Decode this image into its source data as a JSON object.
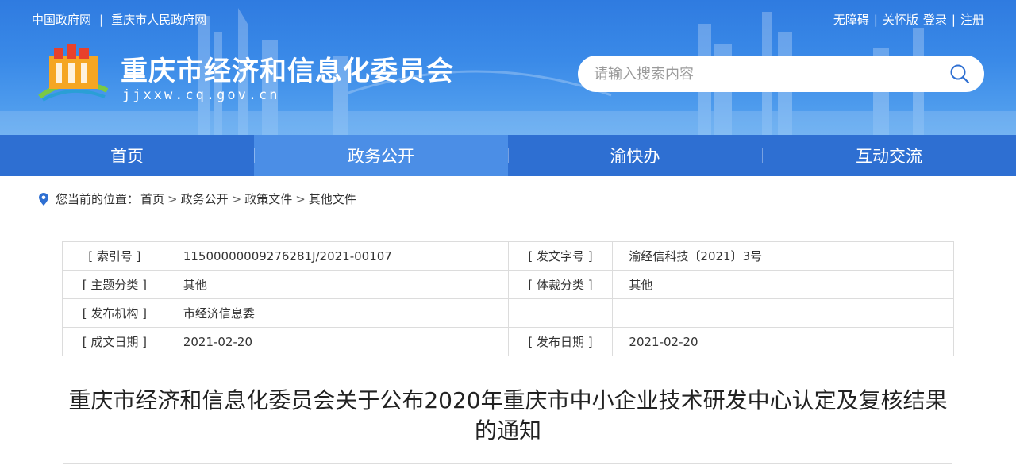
{
  "header": {
    "top_links_left": [
      "中国政府网",
      "重庆市人民政府网"
    ],
    "top_links_right": [
      "无障碍",
      "关怀版",
      "登录",
      "注册"
    ],
    "separator": "|",
    "site_title": "重庆市经济和信息化委员会",
    "site_domain": "jjxxw.cq.gov.cn",
    "search_placeholder": "请输入搜索内容"
  },
  "nav": {
    "items": [
      "首页",
      "政务公开",
      "渝快办",
      "互动交流"
    ],
    "active_index": 1
  },
  "breadcrumb": {
    "prefix": "您当前的位置：",
    "items": [
      "首页",
      "政务公开",
      "政策文件",
      "其他文件"
    ],
    "separator": ">"
  },
  "info": {
    "index_label": "[ 索引号 ]",
    "index_value": "11500000009276281J/2021-00107",
    "doc_no_label": "[ 发文字号 ]",
    "doc_no_value": "渝经信科技〔2021〕3号",
    "topic_label": "[ 主题分类 ]",
    "topic_value": "其他",
    "genre_label": "[ 体裁分类 ]",
    "genre_value": "其他",
    "issuer_label": "[ 发布机构 ]",
    "issuer_value": "市经济信息委",
    "created_label": "[ 成文日期 ]",
    "created_value": "2021-02-20",
    "published_label": "[ 发布日期 ]",
    "published_value": "2021-02-20"
  },
  "article": {
    "title": "重庆市经济和信息化委员会关于公布2020年重庆市中小企业技术研发中心认定及复核结果的通知"
  },
  "colors": {
    "nav_bg": "#2e6fd2",
    "nav_active": "#4b8ee6",
    "header_top": "#2f7be0"
  }
}
